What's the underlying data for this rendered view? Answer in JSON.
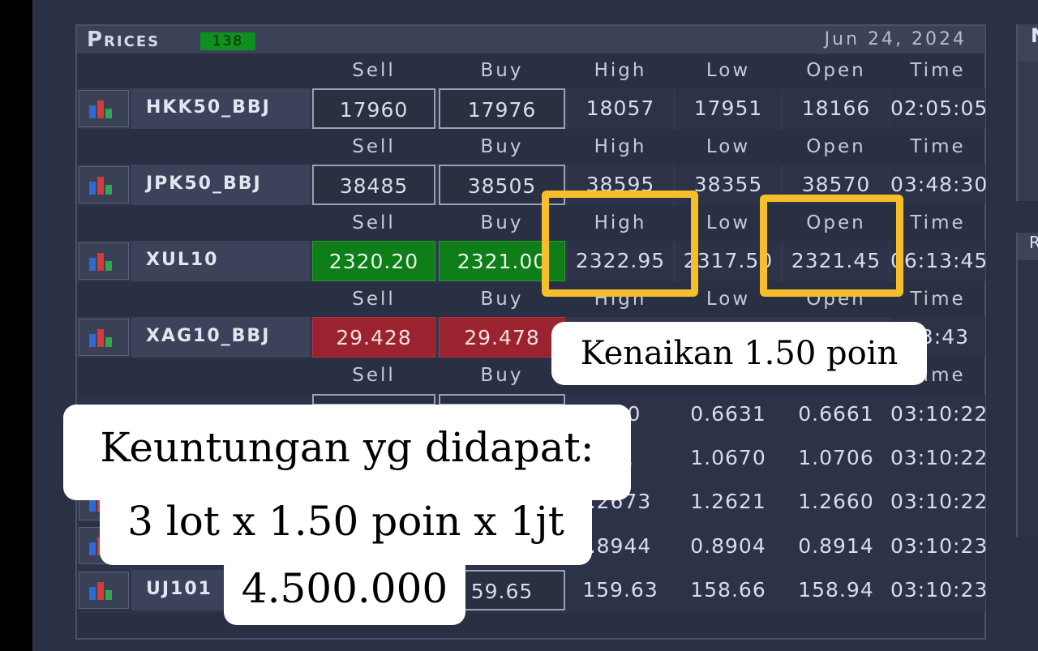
{
  "panel": {
    "title": "Prices",
    "count": "138",
    "date": "Jun 24, 2024"
  },
  "right": {
    "panel1_letter": "N",
    "panel2_letter": "R"
  },
  "columns": [
    "Sell",
    "Buy",
    "High",
    "Low",
    "Open",
    "Time"
  ],
  "rows": [
    {
      "symbol": "HKK50_BBJ",
      "sell": "17960",
      "buy": "17976",
      "high": "18057",
      "low": "17951",
      "open": "18166",
      "time": "02:05:05"
    },
    {
      "symbol": "JPK50_BBJ",
      "sell": "38485",
      "buy": "38505",
      "high": "38595",
      "low": "38355",
      "open": "38570",
      "time": "03:48:30"
    },
    {
      "symbol": "XUL10",
      "sell": "2320.20",
      "buy": "2321.00",
      "high": "2322.95",
      "low": "2317.50",
      "open": "2321.45",
      "time": "06:13:45"
    },
    {
      "symbol": "XAG10_BBJ",
      "sell": "29.428",
      "buy": "29.478",
      "time": "13:43"
    }
  ],
  "compact_rows": [
    {
      "high": "670",
      "low": "0.6631",
      "open": "0.6661",
      "time": "03:10:22"
    },
    {
      "high": "21",
      "low": "1.0670",
      "open": "1.0706",
      "time": "03:10:22"
    },
    {
      "high": ".2673",
      "low": "1.2621",
      "open": "1.2660",
      "time": "03:10:22"
    },
    {
      "high": ".8944",
      "low": "0.8904",
      "open": "0.8914",
      "time": "03:10:23"
    },
    {
      "symbol": "UJ101",
      "buy": "59.65",
      "high": "159.63",
      "low": "158.66",
      "open": "158.94",
      "time": "03:10:23"
    }
  ],
  "annotations": {
    "kenaikan": "Kenaikan 1.50 poin",
    "profit_line1": "Keuntungan yg didapat:",
    "profit_line2": "3 lot x 1.50 poin x 1jt",
    "profit_line3": "4.500.000"
  },
  "colors": {
    "up": "#0f7d18",
    "down": "#9b2330",
    "highlight": "#f5be2a",
    "badge": "#0e8f1e"
  }
}
